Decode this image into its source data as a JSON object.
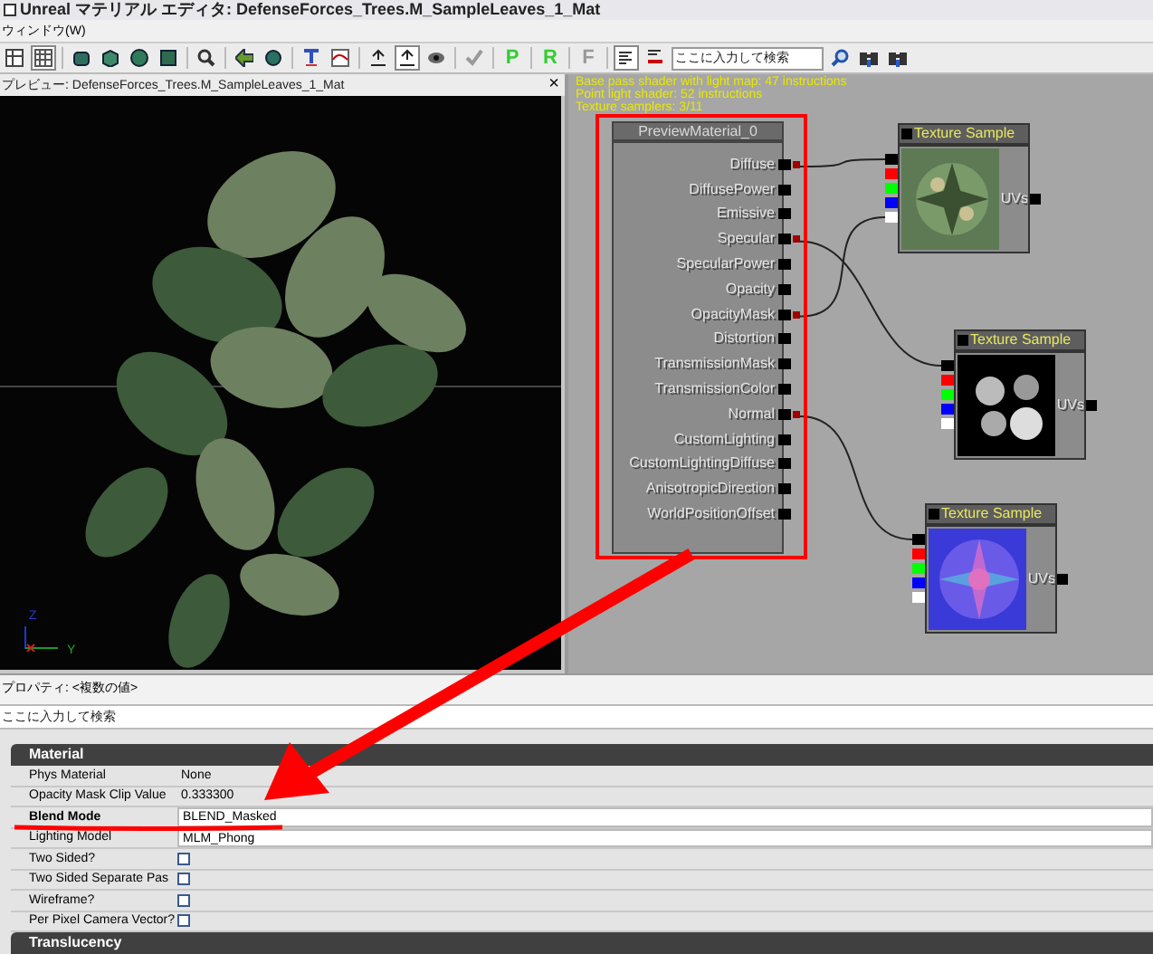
{
  "window": {
    "title": "Unreal マテリアル エディタ: DefenseForces_Trees.M_SampleLeaves_1_Mat"
  },
  "menu": [
    "ウィンドウ(W)"
  ],
  "toolbar": {
    "letter_buttons": [
      {
        "label": "P",
        "disabled": false
      },
      {
        "label": "R",
        "disabled": false
      },
      {
        "label": "F",
        "disabled": true
      }
    ],
    "search": {
      "placeholder": "ここに入力して検索"
    }
  },
  "preview": {
    "title": "プレビュー: DefenseForces_Trees.M_SampleLeaves_1_Mat",
    "close": "×",
    "axes": [
      "Z",
      "Y"
    ]
  },
  "canvas": {
    "stats": [
      "Base pass shader with light map: 47 instructions",
      "Point light shader: 52 instructions",
      "Texture samplers: 3/11"
    ],
    "material_node": {
      "title": "PreviewMaterial_0",
      "inputs": [
        {
          "label": "Diffuse",
          "connected": true
        },
        {
          "label": "DiffusePower",
          "connected": false
        },
        {
          "label": "Emissive",
          "connected": false
        },
        {
          "label": "Specular",
          "connected": true
        },
        {
          "label": "SpecularPower",
          "connected": false
        },
        {
          "label": "Opacity",
          "connected": false
        },
        {
          "label": "OpacityMask",
          "connected": true
        },
        {
          "label": "Distortion",
          "connected": false
        },
        {
          "label": "TransmissionMask",
          "connected": false
        },
        {
          "label": "TransmissionColor",
          "connected": false
        },
        {
          "label": "Normal",
          "connected": true
        },
        {
          "label": "CustomLighting",
          "connected": false
        },
        {
          "label": "CustomLightingDiffuse",
          "connected": false
        },
        {
          "label": "AnisotropicDirection",
          "connected": false
        },
        {
          "label": "WorldPositionOffset",
          "connected": false
        }
      ]
    },
    "texture_nodes": [
      {
        "title": "Texture Sample",
        "output": "UVs",
        "kind": "diffuse"
      },
      {
        "title": "Texture Sample",
        "output": "UVs",
        "kind": "mask"
      },
      {
        "title": "Texture Sample",
        "output": "UVs",
        "kind": "normal"
      }
    ]
  },
  "properties": {
    "title": "プロパティ: <複数の値>",
    "search": {
      "placeholder": "ここに入力して検索"
    },
    "categories": [
      {
        "name": "Material",
        "rows": [
          {
            "kind": "text",
            "label": "Phys Material",
            "value": "None",
            "bold": false
          },
          {
            "kind": "text",
            "label": "Opacity Mask Clip Value",
            "value": "0.333300",
            "bold": false
          },
          {
            "kind": "field",
            "label": "Blend Mode",
            "value": "BLEND_Masked",
            "bold": true
          },
          {
            "kind": "field",
            "label": "Lighting Model",
            "value": "MLM_Phong",
            "bold": false
          },
          {
            "kind": "checkbox",
            "label": "Two Sided?",
            "checked": false,
            "bold": false
          },
          {
            "kind": "checkbox",
            "label": "Two Sided Separate Pas",
            "checked": false,
            "bold": false
          },
          {
            "kind": "checkbox",
            "label": "Wireframe?",
            "checked": false,
            "bold": false
          },
          {
            "kind": "checkbox",
            "label": "Per Pixel Camera Vector?",
            "checked": false,
            "bold": false
          }
        ]
      },
      {
        "name": "Translucency"
      }
    ]
  }
}
